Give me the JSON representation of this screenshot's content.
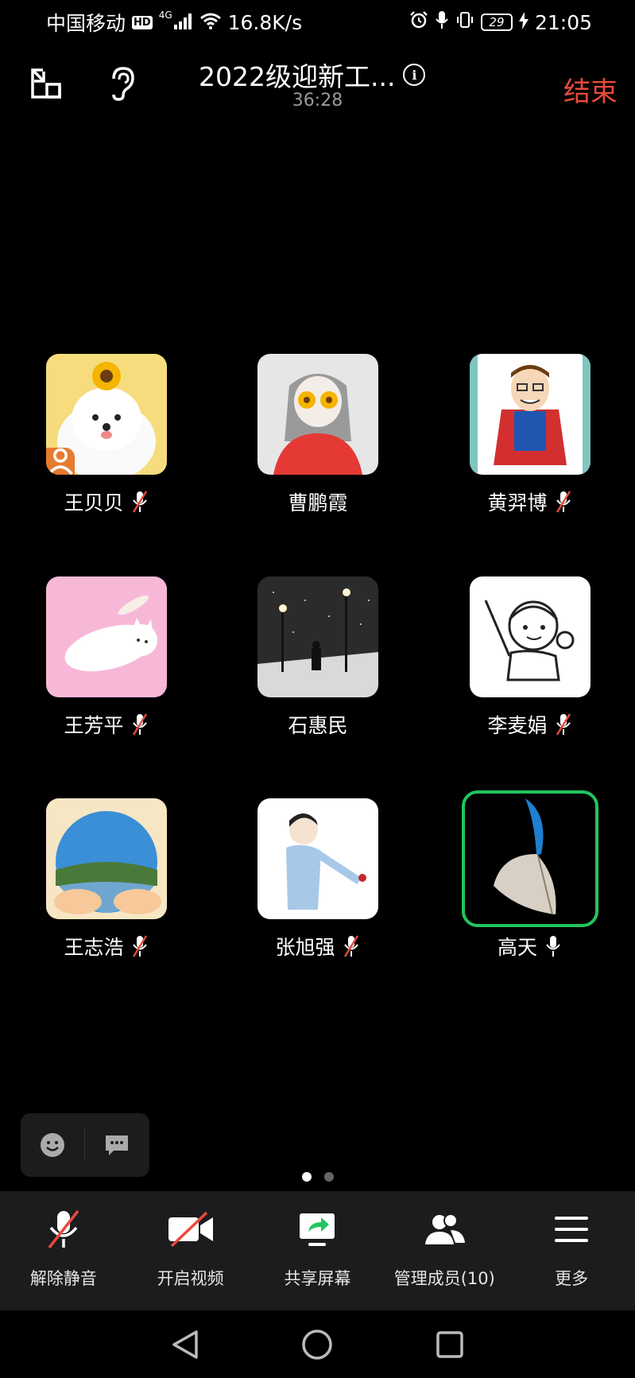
{
  "status_bar": {
    "carrier": "中国移动",
    "hd_badge": "HD",
    "network_type": "4G",
    "net_speed": "16.8K/s",
    "battery_level": "29",
    "time": "21:05"
  },
  "header": {
    "title": "2022级迎新工...",
    "timer": "36:28",
    "end_label": "结束"
  },
  "participants": [
    {
      "name": "王贝贝",
      "muted": true,
      "host": true,
      "avatar": "samoyed-sunflower"
    },
    {
      "name": "曹鹏霞",
      "muted": false,
      "avatar": "girl-flower-eyes"
    },
    {
      "name": "黄羿博",
      "muted": true,
      "avatar": "cartoon-superhero"
    },
    {
      "name": "王芳平",
      "muted": true,
      "avatar": "pink-cat"
    },
    {
      "name": "石惠民",
      "muted": false,
      "avatar": "snowy-street"
    },
    {
      "name": "李麦娟",
      "muted": true,
      "avatar": "cartoon-girl-sketch"
    },
    {
      "name": "王志浩",
      "muted": true,
      "avatar": "lake-landscape"
    },
    {
      "name": "张旭强",
      "muted": true,
      "avatar": "boy-with-rose"
    },
    {
      "name": "高天",
      "muted": false,
      "speaking": true,
      "avatar": "feather"
    }
  ],
  "page_dots": {
    "count": 2,
    "active": 1
  },
  "toolbar": {
    "unmute": "解除静音",
    "start_video": "开启视频",
    "share_screen": "共享屏幕",
    "manage_members": "管理成员(10)",
    "more": "更多"
  },
  "colors": {
    "end_red": "#e84a3b",
    "speaking_green": "#22c55e",
    "host_orange": "#e67a2e",
    "toolbar_bg": "#1c1c1e"
  }
}
